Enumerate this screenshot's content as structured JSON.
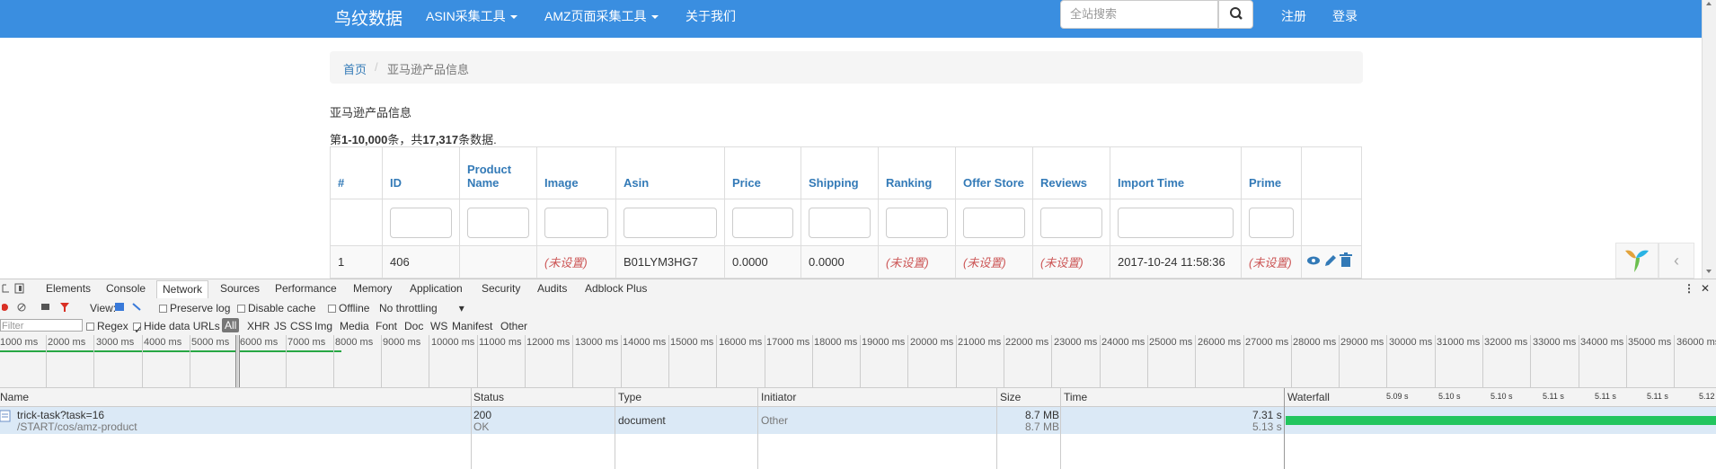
{
  "navbar": {
    "brand": "鸟纹数据",
    "items": [
      {
        "label": "ASIN采集工具",
        "dropdown": true
      },
      {
        "label": "AMZ页面采集工具",
        "dropdown": true
      },
      {
        "label": "关于我们",
        "dropdown": false
      }
    ],
    "search_placeholder": "全站搜索",
    "register": "注册",
    "login": "登录",
    "color": "#3a8ee0"
  },
  "breadcrumb": {
    "home": "首页",
    "separator": "/",
    "current": "亚马逊产品信息"
  },
  "page_title": "亚马逊产品信息",
  "summary": {
    "prefix": "第",
    "range": "1-10,000",
    "mid": "条，共",
    "total": "17,317",
    "suffix": "条数据."
  },
  "table": {
    "headers": [
      "#",
      "ID",
      "Product Name",
      "Image",
      "Asin",
      "Price",
      "Shipping",
      "Ranking",
      "Offer Store",
      "Reviews",
      "Import Time",
      "Prime",
      ""
    ],
    "rows": [
      {
        "num": "1",
        "id": "406",
        "product_name": "",
        "image": "(未设置)",
        "asin": "B01LYM3HG7",
        "price": "0.0000",
        "shipping": "0.0000",
        "ranking": "(未设置)",
        "offer_store": "(未设置)",
        "reviews": "(未设置)",
        "import_time": "2017-10-24 11:58:36",
        "prime": "(未设置)"
      }
    ]
  },
  "yii_toggle": "‹",
  "devtools": {
    "tabs": [
      "Elements",
      "Console",
      "Network",
      "Sources",
      "Performance",
      "Memory",
      "Application",
      "Security",
      "Audits",
      "Adblock Plus"
    ],
    "active_tab": "Network",
    "toolbar": {
      "view_label": "View:",
      "preserve_log": "Preserve log",
      "disable_cache": "Disable cache",
      "offline": "Offline",
      "throttling": "No throttling"
    },
    "filterbar": {
      "filter_placeholder": "Filter",
      "regex": "Regex",
      "hide_data_urls": "Hide data URLs",
      "types": [
        "All",
        "XHR",
        "JS",
        "CSS",
        "Img",
        "Media",
        "Font",
        "Doc",
        "WS",
        "Manifest",
        "Other"
      ]
    },
    "overview_ticks": [
      "1000 ms",
      "2000 ms",
      "3000 ms",
      "4000 ms",
      "5000 ms",
      "6000 ms",
      "7000 ms",
      "8000 ms",
      "9000 ms",
      "10000 ms",
      "11000 ms",
      "12000 ms",
      "13000 ms",
      "14000 ms",
      "15000 ms",
      "16000 ms",
      "17000 ms",
      "18000 ms",
      "19000 ms",
      "20000 ms",
      "21000 ms",
      "22000 ms",
      "23000 ms",
      "24000 ms",
      "25000 ms",
      "26000 ms",
      "27000 ms",
      "28000 ms",
      "29000 ms",
      "30000 ms",
      "31000 ms",
      "32000 ms",
      "33000 ms",
      "34000 ms",
      "35000 ms",
      "36000 ms"
    ],
    "columns": [
      "Name",
      "Status",
      "Type",
      "Initiator",
      "Size",
      "Time",
      "Waterfall"
    ],
    "waterfall_ticks": [
      "5.09 s",
      "5.10 s",
      "5.10 s",
      "5.11 s",
      "5.11 s",
      "5.11 s",
      "5.12"
    ],
    "requests": [
      {
        "name": "trick-task?task=16",
        "path": "/START/cos/amz-product",
        "status": "200",
        "status_text": "OK",
        "type": "document",
        "initiator": "Other",
        "size": "8.7 MB",
        "size2": "8.7 MB",
        "time": "7.31 s",
        "time2": "5.13 s"
      }
    ]
  }
}
